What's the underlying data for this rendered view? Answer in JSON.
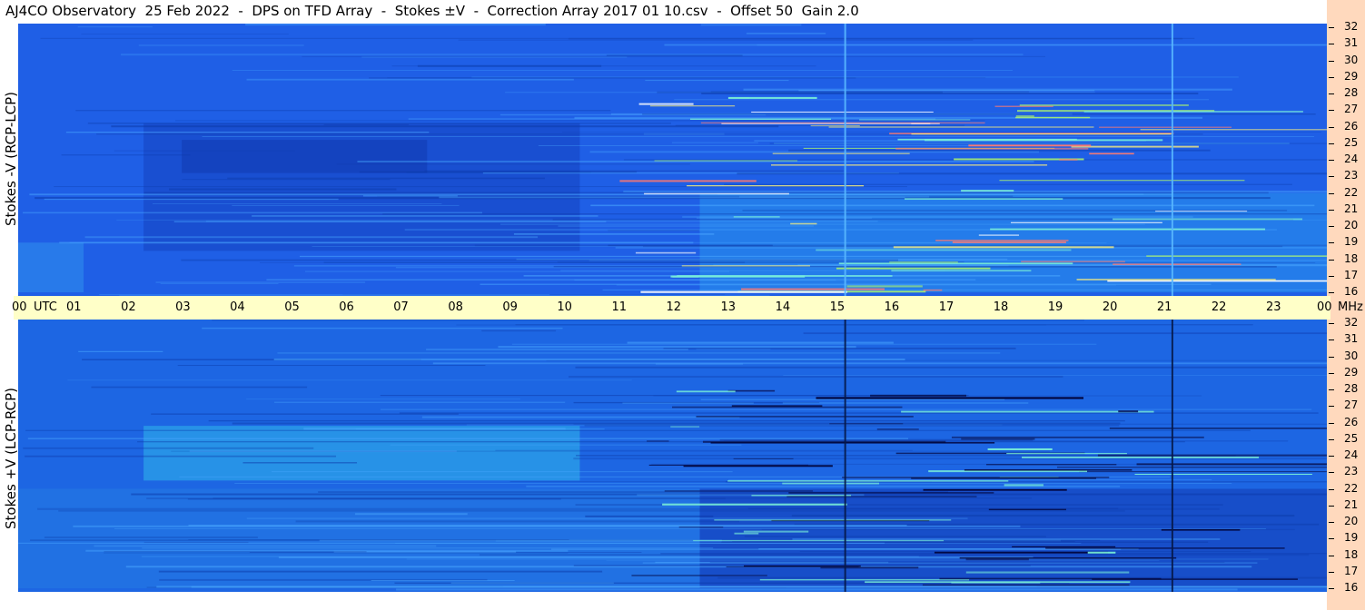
{
  "title": "AJ4CO Observatory  25 Feb 2022  -  DPS on TFD Array  -  Stokes ±V  -  Correction Array 2017 01 10.csv  -  Offset 50  Gain 2.0",
  "chart_data": {
    "type": "heatmap",
    "panels": [
      {
        "label": "Stokes -V (RCP-LCP)",
        "base_color": "#1f5fe6"
      },
      {
        "label": "Stokes +V (LCP-RCP)",
        "base_color": "#1d66e3"
      }
    ],
    "x_axis": {
      "range": [
        0,
        24
      ],
      "tick_labels": [
        "00",
        "01",
        "02",
        "03",
        "04",
        "05",
        "06",
        "07",
        "08",
        "09",
        "10",
        "11",
        "12",
        "13",
        "14",
        "15",
        "16",
        "17",
        "18",
        "19",
        "20",
        "21",
        "22",
        "23",
        "00"
      ],
      "unit_start": "UTC",
      "unit_end": "MHz"
    },
    "y_axis": {
      "range": [
        16,
        32
      ],
      "tick_labels": [
        "32",
        "31",
        "30",
        "29",
        "28",
        "27",
        "26",
        "25",
        "24",
        "23",
        "22",
        "21",
        "20",
        "19",
        "18",
        "17",
        "16"
      ]
    },
    "vertical_lines_utc": [
      15.15,
      21.15
    ]
  }
}
